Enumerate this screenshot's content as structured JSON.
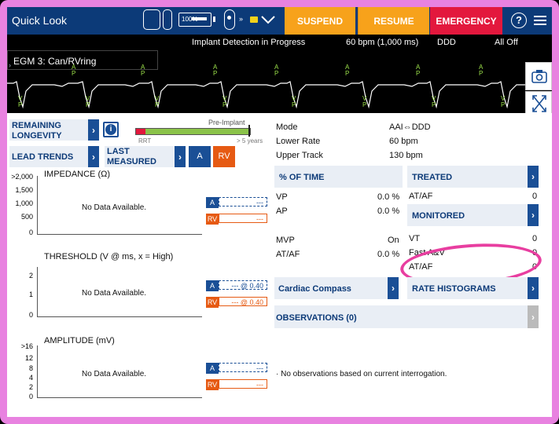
{
  "header": {
    "title": "Quick Look",
    "battery_label": "100%",
    "suspend": "SUSPEND",
    "resume": "RESUME",
    "emergency": "EMERGENCY",
    "colors": {
      "header_bg": "#0c3a78",
      "suspend": "#f7a21b",
      "resume": "#f7a21b",
      "emergency": "#e3183d"
    }
  },
  "status": {
    "message": "Implant Detection in Progress",
    "rate": "60 bpm (1,000 ms)",
    "mode": "DDD",
    "alerts": "All Off"
  },
  "egm": {
    "label": "EGM 3: Can/RVring",
    "markers": [
      "AP",
      "VP",
      "AP",
      "VP",
      "AP",
      "VP",
      "AP",
      "VP",
      "AP",
      "VP",
      "AP",
      "VP"
    ]
  },
  "left_nav": {
    "remaining_longevity": "REMAINING LONGEVITY",
    "lead_trends": "LEAD TRENDS",
    "last_measured": "LAST MEASURED",
    "chamber_a": "A",
    "chamber_rv": "RV",
    "battery_bar": {
      "preimplant_label": "Pre-Implant",
      "rrt_label": "RRT",
      "years_label": "> 5 years",
      "fill_fraction": 0.96
    }
  },
  "trends": {
    "impedance": {
      "title": "IMPEDANCE (Ω)",
      "ticks": [
        ">2,000",
        "1,500",
        "1,000",
        "500",
        "0"
      ],
      "no_data": "No Data Available.",
      "a_label": "A",
      "a_value": "---",
      "rv_label": "RV",
      "rv_value": "---"
    },
    "threshold": {
      "title": "THRESHOLD (V @ ms, x = High)",
      "ticks": [
        "2",
        "1",
        "0"
      ],
      "no_data": "No Data Available.",
      "a_label": "A",
      "a_value": "--- @ 0.40",
      "rv_label": "RV",
      "rv_value": "--- @ 0.40"
    },
    "amplitude": {
      "title": "AMPLITUDE (mV)",
      "ticks": [
        ">16",
        "12",
        "8",
        "4",
        "2",
        "0"
      ],
      "no_data": "No Data Available.",
      "a_label": "A",
      "a_value": "---",
      "rv_label": "RV",
      "rv_value": "---"
    }
  },
  "params": {
    "mode_label": "Mode",
    "mode_value": "AAI⇔DDD",
    "lower_rate_label": "Lower Rate",
    "lower_rate_value": "60 bpm",
    "upper_track_label": "Upper Track",
    "upper_track_value": "130 bpm"
  },
  "percent_time": {
    "title": "% OF TIME",
    "rows": [
      {
        "label": "VP",
        "value": "0.0 %"
      },
      {
        "label": "AP",
        "value": "0.0 %"
      },
      {
        "label": "MVP",
        "value": "On"
      },
      {
        "label": "AT/AF",
        "value": "0.0 %"
      }
    ]
  },
  "treated": {
    "title": "TREATED",
    "rows": [
      {
        "label": "AT/AF",
        "value": "0"
      }
    ]
  },
  "monitored": {
    "title": "MONITORED",
    "rows": [
      {
        "label": "VT",
        "value": "0"
      },
      {
        "label": "Fast A&V",
        "value": "0"
      },
      {
        "label": "AT/AF",
        "value": "0"
      }
    ]
  },
  "buttons": {
    "cardiac_compass": "Cardiac Compass",
    "rate_histograms": "RATE HISTOGRAMS",
    "observations": "OBSERVATIONS (0)"
  },
  "observations_text": "· No observations based on current interrogation."
}
